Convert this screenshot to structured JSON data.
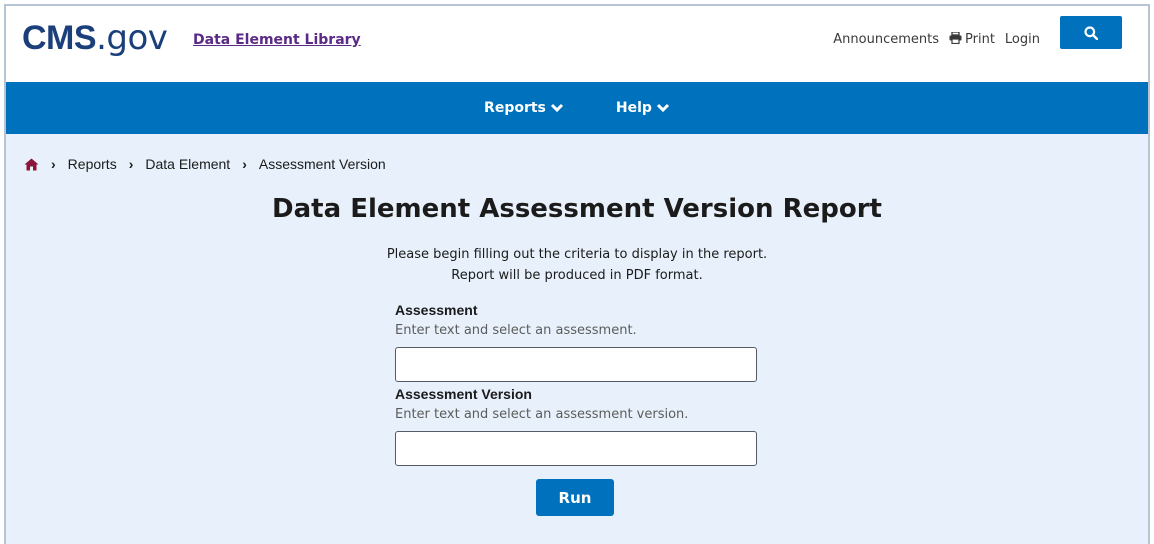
{
  "header": {
    "logo_primary": "CMS",
    "logo_secondary": ".gov",
    "library_link": "Data Element Library",
    "announcements": "Announcements",
    "print": "Print",
    "login": "Login",
    "search_icon": "search-icon"
  },
  "nav": {
    "items": [
      {
        "label": "Reports",
        "icon": "chevron-down-icon"
      },
      {
        "label": "Help",
        "icon": "chevron-down-icon"
      }
    ]
  },
  "breadcrumb": {
    "home_icon": "home-icon",
    "items": [
      "Reports",
      "Data Element",
      "Assessment Version"
    ]
  },
  "page": {
    "title": "Data Element Assessment Version Report",
    "intro_line1": "Please begin filling out the criteria to display in the report.",
    "intro_line2": "Report will be produced in PDF format."
  },
  "form": {
    "assessment": {
      "label": "Assessment",
      "hint": "Enter text and select an assessment.",
      "value": ""
    },
    "assessment_version": {
      "label": "Assessment Version",
      "hint": "Enter text and select an assessment version.",
      "value": ""
    },
    "run_label": "Run"
  },
  "colors": {
    "brand_blue": "#0071bc",
    "logo_navy": "#1a3f7a",
    "link_purple": "#5b2a86",
    "page_bg": "#e8f1fb"
  }
}
